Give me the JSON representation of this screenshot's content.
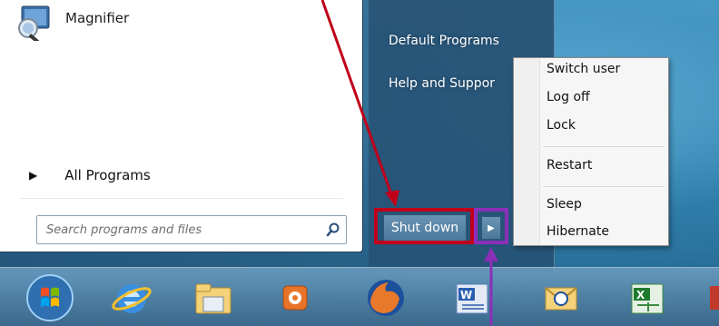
{
  "start_menu": {
    "programs": [
      {
        "label": "Magnifier",
        "icon": "magnifier-icon"
      }
    ],
    "all_programs_label": "All Programs",
    "search": {
      "placeholder": "Search programs and files"
    },
    "right_links": [
      "Default Programs",
      "Help and Suppor"
    ],
    "shutdown_label": "Shut down"
  },
  "context_menu": {
    "items": [
      "Switch user",
      "Log off",
      "Lock",
      "Restart",
      "Sleep",
      "Hibernate"
    ]
  },
  "taskbar": {
    "icons": [
      "start-orb-icon",
      "internet-explorer-icon",
      "file-explorer-icon",
      "media-player-icon",
      "firefox-icon",
      "word-icon",
      "outlook-icon",
      "excel-icon"
    ]
  },
  "colors": {
    "red_highlight": "#c0001a",
    "purple_highlight": "#8a2fb8"
  }
}
